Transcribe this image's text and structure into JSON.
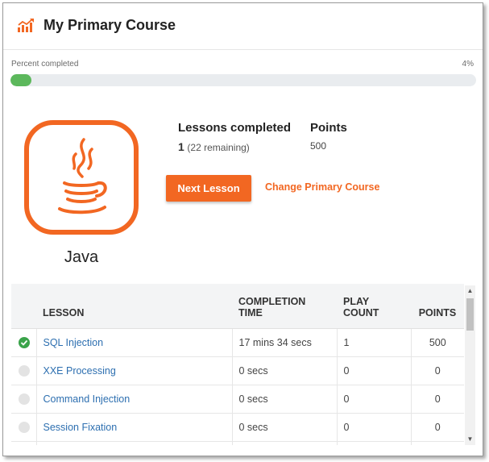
{
  "header": {
    "title": "My Primary Course",
    "icon": "chart-line-icon"
  },
  "progress": {
    "label": "Percent completed",
    "percent_text": "4%",
    "percent": 4
  },
  "course": {
    "name": "Java",
    "logo_icon": "java-coffee-cup-icon"
  },
  "stats": {
    "lessons_label": "Lessons completed",
    "lessons_completed": "1",
    "lessons_remaining": "(22 remaining)",
    "points_label": "Points",
    "points_value": "500"
  },
  "actions": {
    "next_lesson": "Next Lesson",
    "change_course": "Change Primary Course"
  },
  "table": {
    "headers": {
      "lesson": "LESSON",
      "completion_time_1": "COMPLETION",
      "completion_time_2": "TIME",
      "play_count_1": "PLAY",
      "play_count_2": "COUNT",
      "points": "POINTS"
    },
    "rows": [
      {
        "lesson": "SQL Injection",
        "time": "17 mins 34 secs",
        "plays": "1",
        "points": "500",
        "completed": true
      },
      {
        "lesson": "XXE Processing",
        "time": "0 secs",
        "plays": "0",
        "points": "0",
        "completed": false
      },
      {
        "lesson": "Command Injection",
        "time": "0 secs",
        "plays": "0",
        "points": "0",
        "completed": false
      },
      {
        "lesson": "Session Fixation",
        "time": "0 secs",
        "plays": "0",
        "points": "0",
        "completed": false
      }
    ]
  },
  "colors": {
    "accent": "#f26722",
    "progress": "#5cb85c",
    "link": "#2d6fb0",
    "done": "#3aa34a"
  }
}
